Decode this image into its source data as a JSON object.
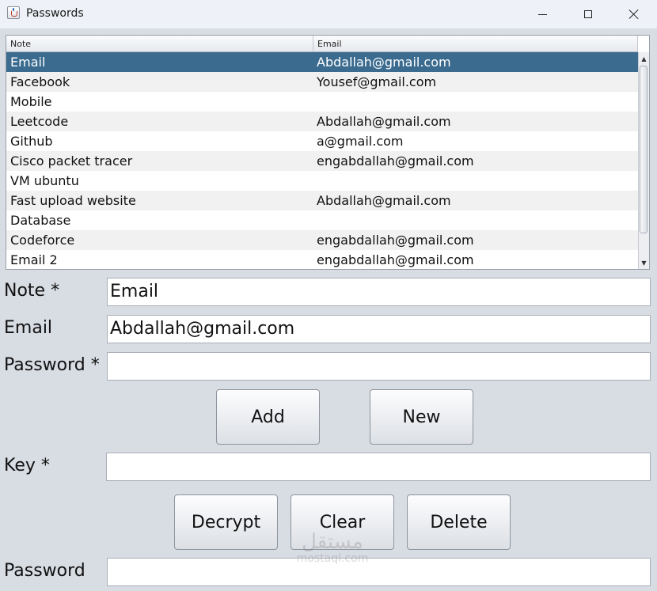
{
  "window": {
    "title": "Passwords",
    "icon": "java-cup-icon"
  },
  "table": {
    "columns": [
      "Note",
      "Email"
    ],
    "rows": [
      {
        "note": "Email",
        "email": "Abdallah@gmail.com",
        "selected": true
      },
      {
        "note": "Facebook",
        "email": "Yousef@gmail.com"
      },
      {
        "note": "Mobile",
        "email": ""
      },
      {
        "note": "Leetcode",
        "email": "Abdallah@gmail.com"
      },
      {
        "note": "Github",
        "email": "a@gmail.com"
      },
      {
        "note": "Cisco packet tracer",
        "email": "engabdallah@gmail.com"
      },
      {
        "note": "VM ubuntu",
        "email": ""
      },
      {
        "note": "Fast upload website",
        "email": "Abdallah@gmail.com"
      },
      {
        "note": "Database",
        "email": ""
      },
      {
        "note": "Codeforce",
        "email": "engabdallah@gmail.com"
      },
      {
        "note": "Email 2",
        "email": "engabdallah@gmail.com"
      }
    ]
  },
  "form": {
    "note_label": "Note *",
    "note_value": "Email",
    "email_label": "Email",
    "email_value": "Abdallah@gmail.com",
    "password_label": "Password *",
    "password_value": "",
    "key_label": "Key *",
    "key_value": "",
    "decrypted_label": "Password",
    "decrypted_value": ""
  },
  "buttons": {
    "add": "Add",
    "new": "New",
    "decrypt": "Decrypt",
    "clear": "Clear",
    "delete": "Delete"
  },
  "watermark": {
    "arabic": "مستقل",
    "latin": "mostaql.com"
  },
  "colors": {
    "selection": "#3b6b8f",
    "window_bg": "#d8dce3"
  }
}
